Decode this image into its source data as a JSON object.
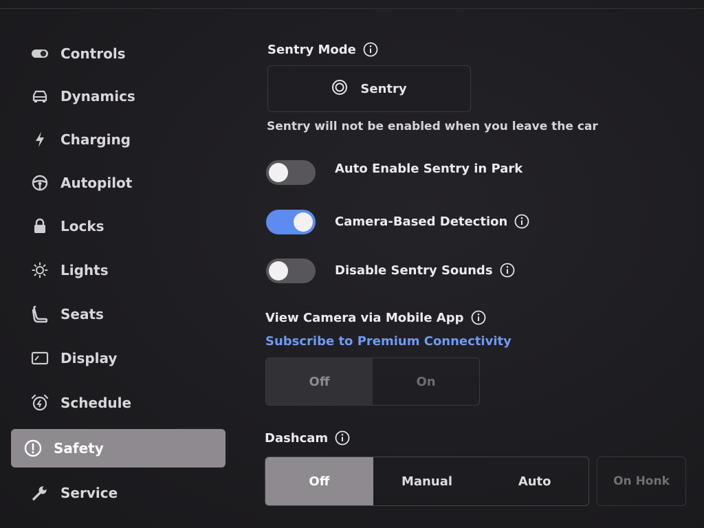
{
  "sidebar": {
    "items": [
      {
        "label": "Controls",
        "icon": "toggle-icon"
      },
      {
        "label": "Dynamics",
        "icon": "car-icon"
      },
      {
        "label": "Charging",
        "icon": "bolt-icon"
      },
      {
        "label": "Autopilot",
        "icon": "steering-wheel-icon"
      },
      {
        "label": "Locks",
        "icon": "lock-icon"
      },
      {
        "label": "Lights",
        "icon": "sun-icon"
      },
      {
        "label": "Seats",
        "icon": "seat-icon"
      },
      {
        "label": "Display",
        "icon": "display-icon"
      },
      {
        "label": "Schedule",
        "icon": "alarm-clock-icon"
      },
      {
        "label": "Safety",
        "icon": "alert-circle-icon",
        "active": true
      },
      {
        "label": "Service",
        "icon": "wrench-icon"
      }
    ]
  },
  "sentry": {
    "title": "Sentry Mode",
    "button_label": "Sentry",
    "note": "Sentry will not be enabled when you leave the car"
  },
  "toggles": {
    "auto_enable": {
      "label": "Auto Enable Sentry in Park",
      "on": false
    },
    "camera_detection": {
      "label": "Camera-Based Detection",
      "on": true
    },
    "disable_sounds": {
      "label": "Disable Sentry Sounds",
      "on": false
    }
  },
  "view_camera": {
    "title": "View Camera via Mobile App",
    "link": "Subscribe to Premium Connectivity",
    "options": [
      "Off",
      "On"
    ],
    "selected": "Off"
  },
  "dashcam": {
    "title": "Dashcam",
    "options": [
      "Off",
      "Manual",
      "Auto"
    ],
    "selected": "Off",
    "extra_option": "On Honk"
  },
  "colors": {
    "accent": "#5d8cf0",
    "link": "#6e9bf2",
    "active_bg": "#8e8a90"
  }
}
